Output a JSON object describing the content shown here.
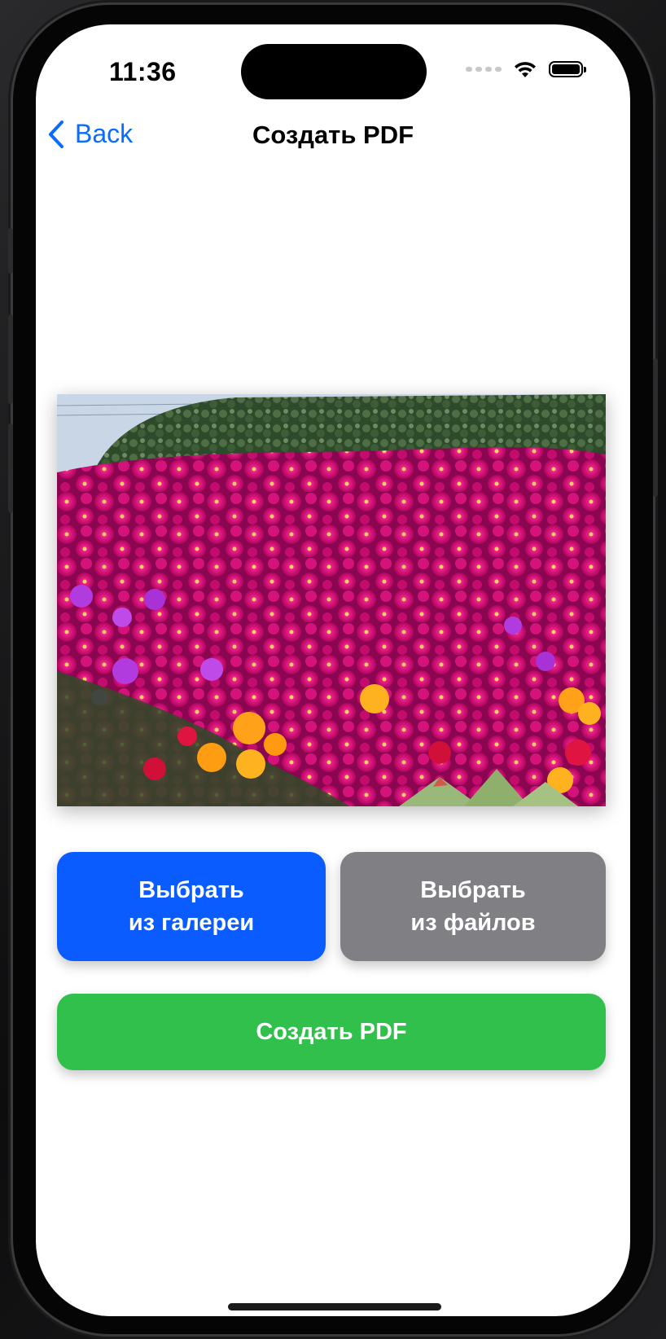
{
  "status_bar": {
    "time": "11:36",
    "icons": [
      "signal-dots-icon",
      "wifi-icon",
      "battery-icon"
    ]
  },
  "nav": {
    "back_label": "Back",
    "title": "Создать PDF",
    "accent_color": "#0a6cff"
  },
  "preview": {
    "icon": "flower-photo"
  },
  "buttons": {
    "gallery": {
      "line1": "Выбрать",
      "line2": "из галереи",
      "color": "#0a5cff"
    },
    "files": {
      "line1": "Выбрать",
      "line2": "из файлов",
      "color": "#7f7f84"
    },
    "create": {
      "label": "Создать PDF",
      "color": "#30c04b"
    }
  }
}
